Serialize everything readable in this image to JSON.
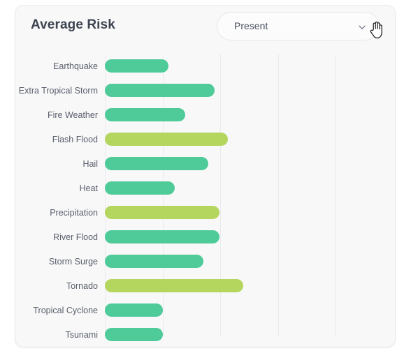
{
  "card": {
    "title": "Average Risk",
    "dropdown": {
      "name": "period-select",
      "value": "Present",
      "icon": "chevron-down-icon"
    },
    "cursor_icon": "pointing-hand-cursor"
  },
  "colors": {
    "card_background": "#f8f8f9",
    "page_background": "#ffffff",
    "title_text": "#3d4450",
    "label_text": "#595f6b",
    "gridline": "#e9eaec",
    "bar_green": "#4ecb99",
    "bar_yellow_green": "#b5d65e",
    "dropdown_border": "#e6e8ec"
  },
  "chart_data": {
    "type": "bar",
    "orientation": "horizontal",
    "title": "Average Risk",
    "xlabel": "",
    "ylabel": "",
    "xlim": [
      0,
      4
    ],
    "grid": true,
    "gridline_values": [
      0,
      1,
      2,
      3,
      4
    ],
    "legend": "none",
    "categories": [
      "Earthquake",
      "Extra Tropical Storm",
      "Fire Weather",
      "Flash Flood",
      "Hail",
      "Heat",
      "Precipitation",
      "River Flood",
      "Storm Surge",
      "Tornado",
      "Tropical Cyclone",
      "Tsunami"
    ],
    "values": [
      1.1,
      1.9,
      1.4,
      2.13,
      1.79,
      1.21,
      1.99,
      1.99,
      1.71,
      2.4,
      1.0,
      1.0
    ],
    "bar_colors": [
      "#4ecb99",
      "#4ecb99",
      "#4ecb99",
      "#b5d65e",
      "#4ecb99",
      "#4ecb99",
      "#b5d65e",
      "#4ecb99",
      "#4ecb99",
      "#b5d65e",
      "#4ecb99",
      "#4ecb99"
    ]
  }
}
